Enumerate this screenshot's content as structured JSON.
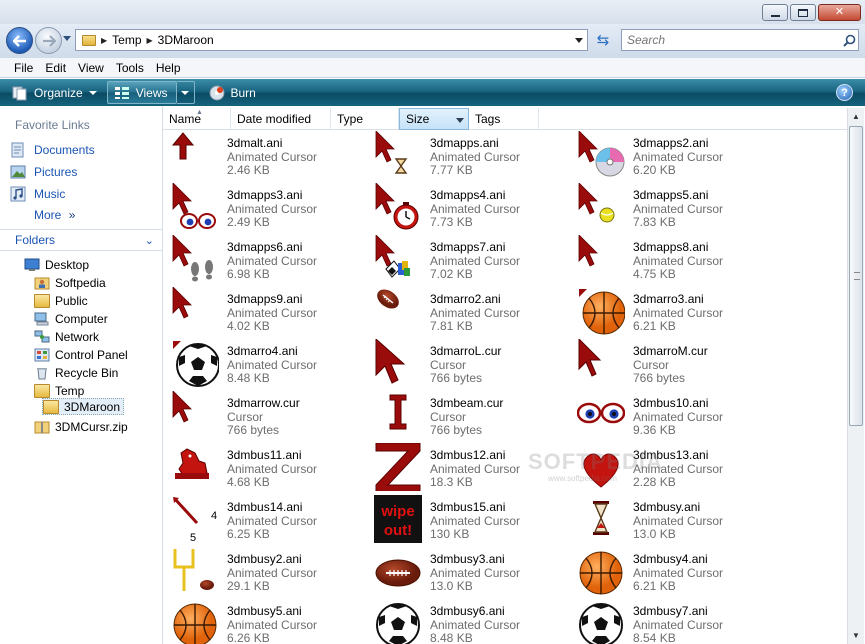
{
  "window": {
    "minimize_icon": "minimize-icon",
    "maximize_icon": "maximize-icon",
    "close_icon": "close-icon"
  },
  "address": {
    "crumbs": [
      "Temp",
      "3DMaroon"
    ],
    "search_placeholder": "Search"
  },
  "menu": [
    "File",
    "Edit",
    "View",
    "Tools",
    "Help"
  ],
  "toolbar": {
    "organize": "Organize",
    "views": "Views",
    "burn": "Burn",
    "help": "?"
  },
  "nav": {
    "favorite_links_heading": "Favorite Links",
    "favorites": [
      "Documents",
      "Pictures",
      "Music"
    ],
    "more": "More",
    "more_glyph": "»",
    "folders_heading": "Folders",
    "tree": [
      "Desktop",
      "Softpedia",
      "Public",
      "Computer",
      "Network",
      "Control Panel",
      "Recycle Bin",
      "Temp",
      "3DMaroon",
      "3DMCursr.zip"
    ]
  },
  "columns": [
    "Name",
    "Date modified",
    "Type",
    "Size",
    "Tags"
  ],
  "files": [
    {
      "name": "3dmalt.ani",
      "type": "Animated Cursor",
      "size": "2.46 KB",
      "icon": "up-arrow-icon"
    },
    {
      "name": "3dmapps.ani",
      "type": "Animated Cursor",
      "size": "7.77 KB",
      "icon": "pointer-hourglass-icon"
    },
    {
      "name": "3dmapps2.ani",
      "type": "Animated Cursor",
      "size": "6.20 KB",
      "icon": "pointer-cd-icon"
    },
    {
      "name": "3dmapps3.ani",
      "type": "Animated Cursor",
      "size": "2.49 KB",
      "icon": "pointer-eyes-icon"
    },
    {
      "name": "3dmapps4.ani",
      "type": "Animated Cursor",
      "size": "7.73 KB",
      "icon": "pointer-stopwatch-icon"
    },
    {
      "name": "3dmapps5.ani",
      "type": "Animated Cursor",
      "size": "7.83 KB",
      "icon": "pointer-tennisball-icon"
    },
    {
      "name": "3dmapps6.ani",
      "type": "Animated Cursor",
      "size": "6.98 KB",
      "icon": "pointer-footprints-icon"
    },
    {
      "name": "3dmapps7.ani",
      "type": "Animated Cursor",
      "size": "7.02 KB",
      "icon": "pointer-flags-icon"
    },
    {
      "name": "3dmapps8.ani",
      "type": "Animated Cursor",
      "size": "4.75 KB",
      "icon": "pointer-icon"
    },
    {
      "name": "3dmapps9.ani",
      "type": "Animated Cursor",
      "size": "4.02 KB",
      "icon": "pointer-icon"
    },
    {
      "name": "3dmarro2.ani",
      "type": "Animated Cursor",
      "size": "7.81 KB",
      "icon": "football-icon"
    },
    {
      "name": "3dmarro3.ani",
      "type": "Animated Cursor",
      "size": "6.21 KB",
      "icon": "basketball-icon"
    },
    {
      "name": "3dmarro4.ani",
      "type": "Animated Cursor",
      "size": "8.48 KB",
      "icon": "soccer-ball-icon"
    },
    {
      "name": "3dmarroL.cur",
      "type": "Cursor",
      "size": "766 bytes",
      "icon": "pointer-large-icon"
    },
    {
      "name": "3dmarroM.cur",
      "type": "Cursor",
      "size": "766 bytes",
      "icon": "pointer-icon"
    },
    {
      "name": "3dmarrow.cur",
      "type": "Cursor",
      "size": "766 bytes",
      "icon": "pointer-icon"
    },
    {
      "name": "3dmbeam.cur",
      "type": "Cursor",
      "size": "766 bytes",
      "icon": "ibeam-icon"
    },
    {
      "name": "3dmbus10.ani",
      "type": "Animated Cursor",
      "size": "9.36 KB",
      "icon": "eyes-icon"
    },
    {
      "name": "3dmbus11.ani",
      "type": "Animated Cursor",
      "size": "4.68 KB",
      "icon": "horse-icon"
    },
    {
      "name": "3dmbus12.ani",
      "type": "Animated Cursor",
      "size": "18.3 KB",
      "icon": "letter-z-icon"
    },
    {
      "name": "3dmbus13.ani",
      "type": "Animated Cursor",
      "size": "2.28 KB",
      "icon": "heart-icon"
    },
    {
      "name": "3dmbus14.ani",
      "type": "Animated Cursor",
      "size": "6.25 KB",
      "icon": "clock-hand-icon"
    },
    {
      "name": "3dmbus15.ani",
      "type": "Animated Cursor",
      "size": "130 KB",
      "icon": "wipe-out-icon"
    },
    {
      "name": "3dmbusy.ani",
      "type": "Animated Cursor",
      "size": "13.0 KB",
      "icon": "hourglass-icon"
    },
    {
      "name": "3dmbusy2.ani",
      "type": "Animated Cursor",
      "size": "29.1 KB",
      "icon": "goalpost-icon"
    },
    {
      "name": "3dmbusy3.ani",
      "type": "Animated Cursor",
      "size": "13.0 KB",
      "icon": "football-icon"
    },
    {
      "name": "3dmbusy4.ani",
      "type": "Animated Cursor",
      "size": "6.21 KB",
      "icon": "basketball-icon"
    },
    {
      "name": "3dmbusy5.ani",
      "type": "Animated Cursor",
      "size": "6.26 KB",
      "icon": "basketball-icon"
    },
    {
      "name": "3dmbusy6.ani",
      "type": "Animated Cursor",
      "size": "8.48 KB",
      "icon": "soccer-ball-icon"
    },
    {
      "name": "3dmbusy7.ani",
      "type": "Animated Cursor",
      "size": "8.54 KB",
      "icon": "soccer-ball-icon"
    }
  ],
  "clock_hand_digits": [
    "4",
    "5"
  ],
  "wipe_out_text": [
    "wipe",
    "out!"
  ],
  "watermark": "SOFTPEDIA",
  "watermark_url": "www.softpedia.com",
  "colors": {
    "maroon": "#9a0b0b",
    "toolbar": "#15607d",
    "link": "#1a55b3"
  }
}
